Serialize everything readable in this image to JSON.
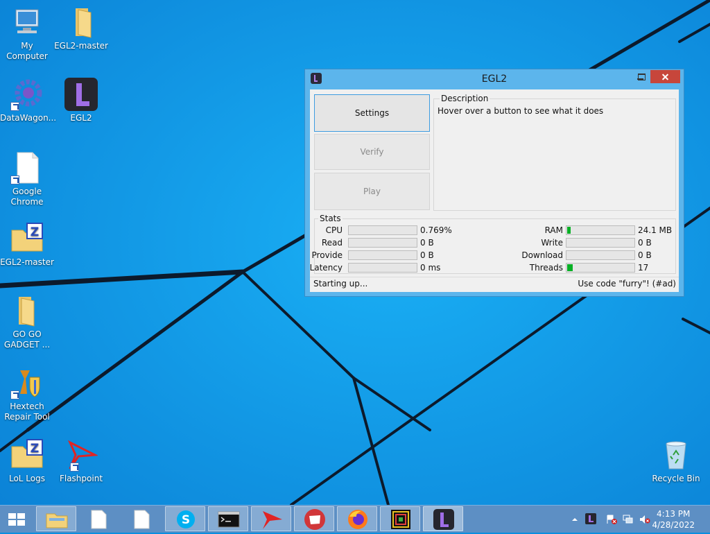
{
  "desktop": {
    "icons": [
      {
        "label": "My Computer"
      },
      {
        "label": "EGL2-master"
      },
      {
        "label": "DataWagon..."
      },
      {
        "label": "EGL2"
      },
      {
        "label": "Google Chrome"
      },
      {
        "label": "EGL2-master"
      },
      {
        "label": "GO GO GADGET ..."
      },
      {
        "label": "Hextech Repair Tool"
      },
      {
        "label": "LoL Logs"
      },
      {
        "label": "Flashpoint"
      },
      {
        "label": "Recycle Bin"
      }
    ]
  },
  "window": {
    "title": "EGL2",
    "buttons": {
      "settings": "Settings",
      "verify": "Verify",
      "play": "Play"
    },
    "description": {
      "legend": "Description",
      "text": "Hover over a button to see what it does"
    },
    "stats": {
      "legend": "Stats",
      "left": [
        {
          "label": "CPU",
          "value": "0.769%",
          "fill": 0
        },
        {
          "label": "Read",
          "value": "0 B",
          "fill": 0
        },
        {
          "label": "Provide",
          "value": "0 B",
          "fill": 0
        },
        {
          "label": "Latency",
          "value": "0 ms",
          "fill": 0
        }
      ],
      "right": [
        {
          "label": "RAM",
          "value": "24.1 MB",
          "fill": 0.05
        },
        {
          "label": "Write",
          "value": "0 B",
          "fill": 0
        },
        {
          "label": "Download",
          "value": "0 B",
          "fill": 0
        },
        {
          "label": "Threads",
          "value": "17",
          "fill": 0.08
        }
      ]
    },
    "status": {
      "left": "Starting up...",
      "right": "Use code \"furry\"! (#ad)"
    }
  },
  "taskbar": {
    "items": [
      "file-explorer",
      "document",
      "document",
      "skype",
      "command-prompt",
      "flashpoint",
      "riot-client",
      "firefox",
      "game-app",
      "egl2"
    ],
    "clock": {
      "time": "4:13 PM",
      "date": "4/28/2022"
    }
  },
  "colors": {
    "accent": "#06b025",
    "close": "#c7463b",
    "wallpaper": "#0a8ee0"
  }
}
